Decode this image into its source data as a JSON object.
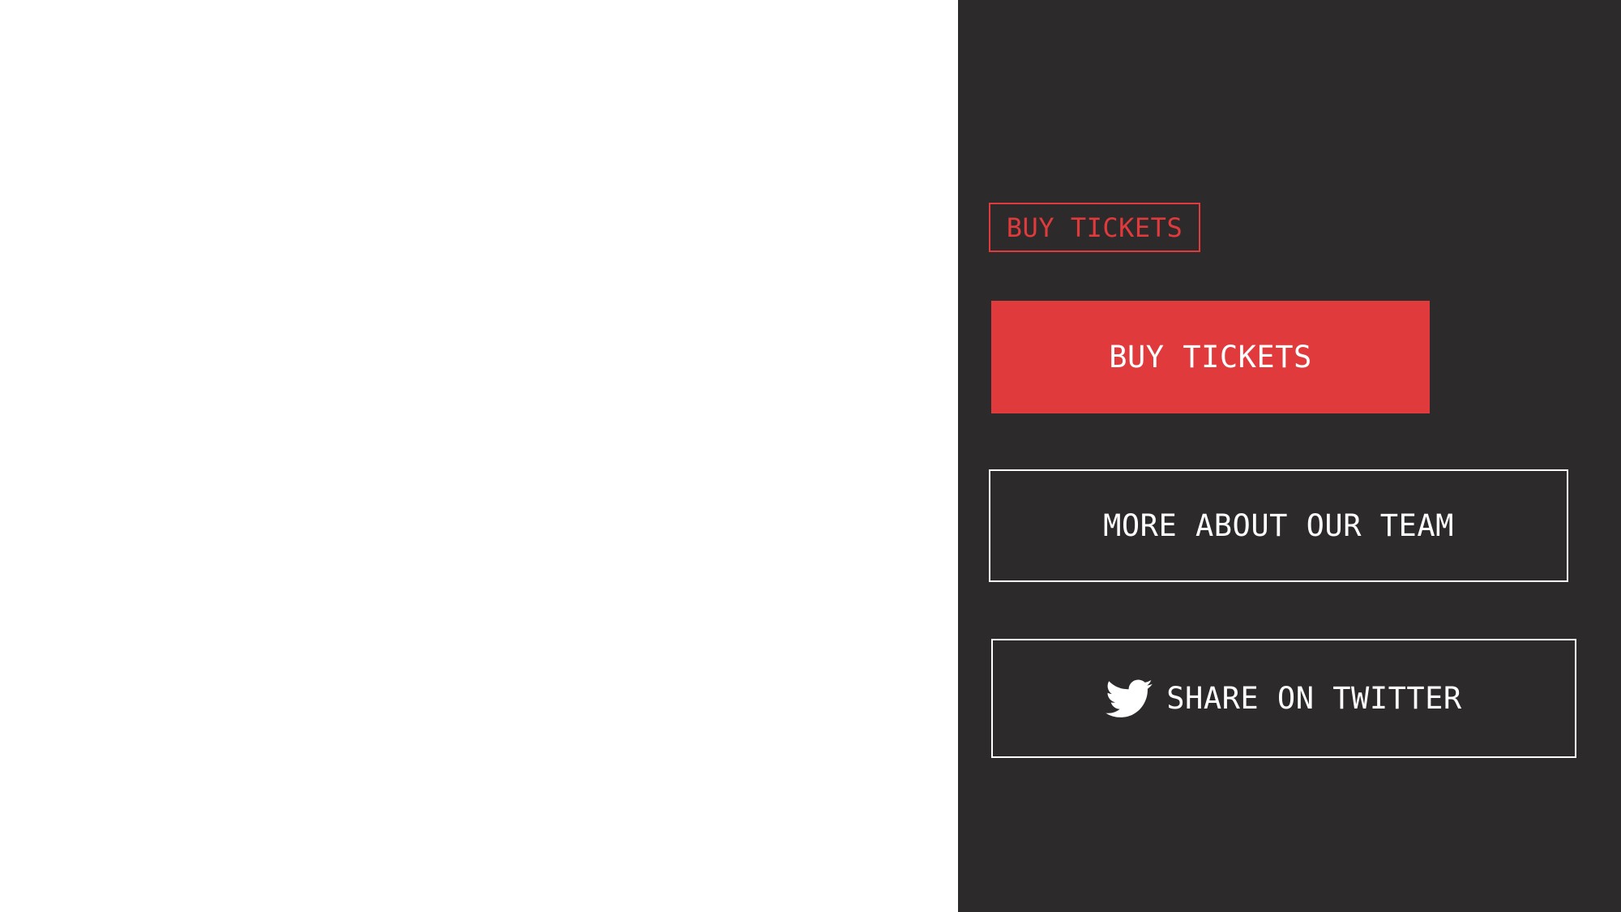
{
  "buttons": {
    "buy_tickets_outline": "BUY TICKETS",
    "buy_tickets_filled": "BUY TICKETS",
    "more_about_team": "MORE ABOUT OUR TEAM",
    "share_twitter": "SHARE ON TWITTER"
  },
  "icons": {
    "share_twitter_icon": "twitter-bird-icon"
  },
  "colors": {
    "panel_background": "#2d2a2b",
    "accent_red": "#e03a3c",
    "text_white": "#ffffff",
    "page_background": "#ffffff"
  }
}
